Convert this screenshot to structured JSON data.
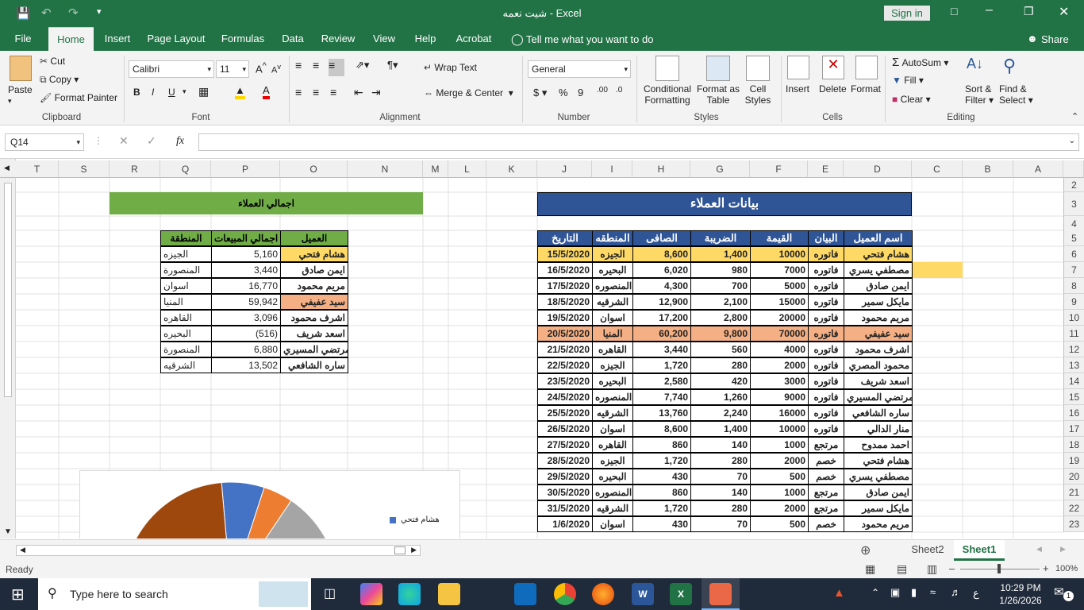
{
  "window": {
    "title": "شيت نعمه  -  Excel",
    "sign_in": "Sign in"
  },
  "tabs": [
    "File",
    "Home",
    "Insert",
    "Page Layout",
    "Formulas",
    "Data",
    "Review",
    "View",
    "Help",
    "Acrobat"
  ],
  "tell_me": "Tell me what you want to do",
  "share": "Share",
  "ribbon": {
    "clipboard": {
      "paste": "Paste",
      "cut": "Cut",
      "copy": "Copy",
      "format_painter": "Format Painter",
      "label": "Clipboard"
    },
    "font": {
      "name": "Calibri",
      "size": "11",
      "label": "Font"
    },
    "alignment": {
      "wrap": "Wrap Text",
      "merge": "Merge & Center",
      "label": "Alignment"
    },
    "number": {
      "format": "General",
      "label": "Number"
    },
    "styles": {
      "conditional": "Conditional",
      "formatting": "Formatting",
      "format_as": "Format as",
      "table": "Table",
      "cell": "Cell",
      "styles": "Styles",
      "label": "Styles"
    },
    "cells": {
      "insert": "Insert",
      "delete": "Delete",
      "format": "Format",
      "label": "Cells"
    },
    "editing": {
      "autosum": "AutoSum",
      "fill": "Fill",
      "clear": "Clear",
      "sort": "Sort &",
      "filter": "Filter",
      "find": "Find &",
      "select": "Select",
      "label": "Editing"
    }
  },
  "namebox": "Q14",
  "fx": "fx",
  "columns": [
    {
      "l": "T"
    },
    {
      "l": "S"
    },
    {
      "l": "R"
    },
    {
      "l": "Q"
    },
    {
      "l": "P"
    },
    {
      "l": "O"
    },
    {
      "l": "N"
    },
    {
      "l": "M"
    },
    {
      "l": "L"
    },
    {
      "l": "K"
    },
    {
      "l": "J"
    },
    {
      "l": "I"
    },
    {
      "l": "H"
    },
    {
      "l": "G"
    },
    {
      "l": "F"
    },
    {
      "l": "E"
    },
    {
      "l": "D"
    },
    {
      "l": "C"
    },
    {
      "l": "B"
    },
    {
      "l": "A"
    }
  ],
  "rows": [
    "2",
    "3",
    "4",
    "5",
    "6",
    "7",
    "8",
    "9",
    "10",
    "11",
    "12",
    "13",
    "14",
    "15",
    "16",
    "17",
    "18",
    "19",
    "20",
    "21",
    "22",
    "23"
  ],
  "main_table": {
    "title": "بيانات العملاء",
    "headers": [
      "اسم العميل",
      "البيان",
      "القيمة",
      "الضريبة",
      "الصافى",
      "المنطقه",
      "التاريخ"
    ],
    "rows": [
      [
        "هشام فتحي",
        "فاتوره",
        "10000",
        "1,400",
        "8,600",
        "الجيزه",
        "15/5/2020",
        "yel"
      ],
      [
        "مصطفي يسري",
        "فاتوره",
        "7000",
        "980",
        "6,020",
        "البحيره",
        "16/5/2020",
        ""
      ],
      [
        "ايمن صادق",
        "فاتوره",
        "5000",
        "700",
        "4,300",
        "المنصوره",
        "17/5/2020",
        ""
      ],
      [
        "مايكل سمير",
        "فاتوره",
        "15000",
        "2,100",
        "12,900",
        "الشرقيه",
        "18/5/2020",
        ""
      ],
      [
        "مريم محمود",
        "فاتوره",
        "20000",
        "2,800",
        "17,200",
        "اسوان",
        "19/5/2020",
        ""
      ],
      [
        "سيد عفيفي",
        "فاتوره",
        "70000",
        "9,800",
        "60,200",
        "المنيا",
        "20/5/2020",
        "org"
      ],
      [
        "اشرف محمود",
        "فاتوره",
        "4000",
        "560",
        "3,440",
        "القاهره",
        "21/5/2020",
        ""
      ],
      [
        "محمود المصري",
        "فاتوره",
        "2000",
        "280",
        "1,720",
        "الجيزه",
        "22/5/2020",
        ""
      ],
      [
        "اسعد شريف",
        "فاتوره",
        "3000",
        "420",
        "2,580",
        "البحيره",
        "23/5/2020",
        ""
      ],
      [
        "مرتضي المسيري",
        "فاتوره",
        "9000",
        "1,260",
        "7,740",
        "المنصوره",
        "24/5/2020",
        ""
      ],
      [
        "ساره الشافعي",
        "فاتوره",
        "16000",
        "2,240",
        "13,760",
        "الشرقيه",
        "25/5/2020",
        ""
      ],
      [
        "منار الدالي",
        "فاتوره",
        "10000",
        "1,400",
        "8,600",
        "اسوان",
        "26/5/2020",
        ""
      ],
      [
        "احمد ممدوح",
        "مرتجع",
        "1000",
        "140",
        "860",
        "القاهره",
        "27/5/2020",
        ""
      ],
      [
        "هشام فتحي",
        "خصم",
        "2000",
        "280",
        "1,720",
        "الجيزه",
        "28/5/2020",
        ""
      ],
      [
        "مصطفي يسري",
        "خصم",
        "500",
        "70",
        "430",
        "البحيره",
        "29/5/2020",
        ""
      ],
      [
        "ايمن صادق",
        "مرتجع",
        "1000",
        "140",
        "860",
        "المنصوره",
        "30/5/2020",
        ""
      ],
      [
        "مايكل سمير",
        "مرتجع",
        "2000",
        "280",
        "1,720",
        "الشرقيه",
        "31/5/2020",
        ""
      ],
      [
        "مريم محمود",
        "خصم",
        "500",
        "70",
        "430",
        "اسوان",
        "1/6/2020",
        ""
      ]
    ]
  },
  "summary": {
    "title": "اجمالي العملاء",
    "headers": [
      "العميل",
      "اجمالي المبيعات",
      "المنطقة"
    ],
    "rows": [
      [
        "هشام فتحي",
        "5,160",
        "الجيزه",
        "yel"
      ],
      [
        "ايمن صادق",
        "3,440",
        "المنصورة",
        ""
      ],
      [
        "مريم محمود",
        "16,770",
        "اسوان",
        ""
      ],
      [
        "سيد عفيفي",
        "59,942",
        "المنيا",
        "org"
      ],
      [
        "اشرف محمود",
        "3,096",
        "القاهره",
        ""
      ],
      [
        "اسعد شريف",
        "(516)",
        "البحيره",
        ""
      ],
      [
        "مرتضي المسيري",
        "6,880",
        "المنصورة",
        ""
      ],
      [
        "ساره الشافعي",
        "13,502",
        "الشرقيه",
        ""
      ]
    ]
  },
  "chart_data": {
    "type": "pie",
    "legend": [
      "هشام فتحي"
    ],
    "colors": [
      "#4472c4",
      "#ed7d31",
      "#a5a5a5",
      "#ffc000",
      "#5b9bd5",
      "#70ad47",
      "#264478",
      "#9e480e"
    ]
  },
  "sheets": [
    "Sheet2",
    "Sheet1"
  ],
  "status": {
    "ready": "Ready",
    "zoom": "100%"
  },
  "taskbar": {
    "search": "Type here to search",
    "time": "10:29 PM",
    "date": "1/26/2026",
    "lang": "ع",
    "notif": "1"
  }
}
